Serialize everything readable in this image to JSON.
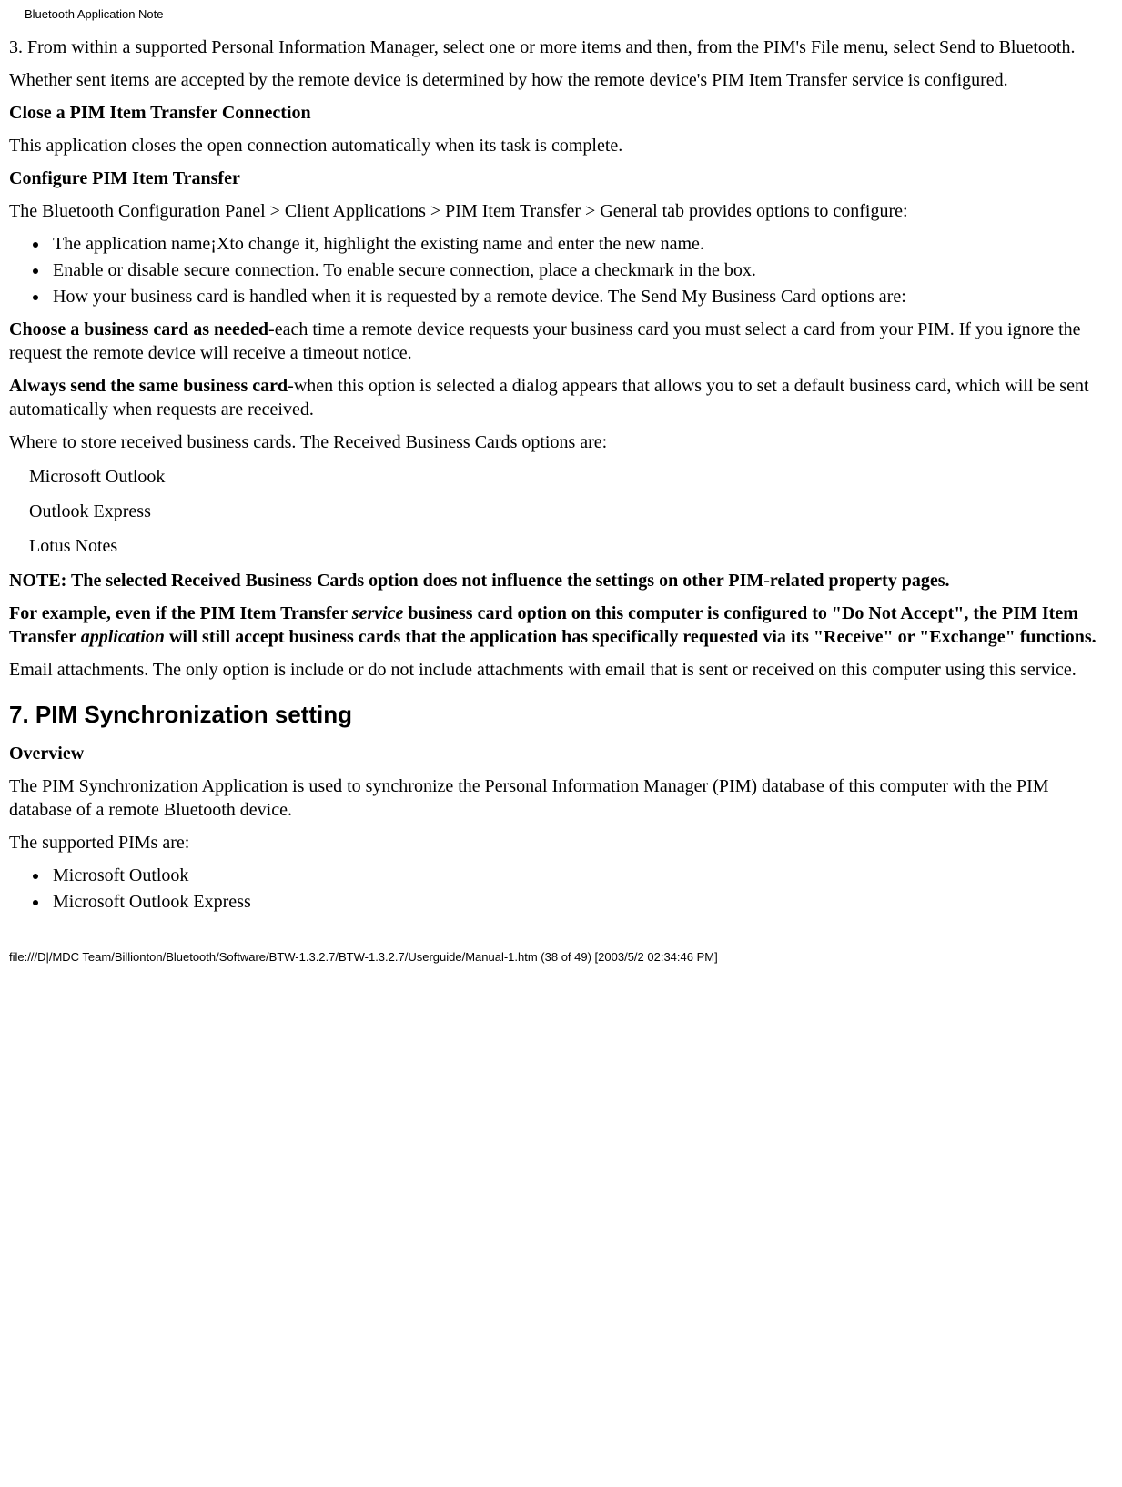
{
  "header": "Bluetooth Application Note",
  "p1": "3. From within a supported Personal Information Manager, select one or more items and then, from the PIM's File menu, select Send to Bluetooth.",
  "p2": "Whether sent items are accepted by the remote device is determined by how the remote device's PIM Item Transfer service is configured.",
  "h_close": "Close a PIM Item Transfer Connection",
  "p3": "This application closes the open connection automatically when its task is complete.",
  "h_configure": "Configure PIM Item Transfer",
  "p4": "The Bluetooth Configuration Panel > Client Applications > PIM Item Transfer > General tab provides options to configure:",
  "bullets1": {
    "b1": " The application name¡Xto change it, highlight the existing name and enter the new name.",
    "b2": "Enable or disable secure connection. To enable secure connection, place a checkmark in the box.",
    "b3": "How your business card is handled when it is requested by a remote device. The Send My Business Card options are:"
  },
  "choose_bold": "Choose a business card as needed",
  "choose_rest": "-each time a remote device requests your business card you must select a card from your PIM. If you ignore the request the remote device will receive a timeout notice.",
  "always_bold": "Always send the same business card",
  "always_rest": "-when this option is selected a dialog appears that allows you to set a default business card, which will be sent automatically when requests are received.",
  "p_where": "Where to store received business cards. The Received Business Cards options are:",
  "opts": {
    "o1": " Microsoft Outlook",
    "o2": " Outlook Express",
    "o3": "Lotus Notes"
  },
  "note1": "NOTE: The selected Received Business Cards option does not influence the settings on other PIM-related property pages.",
  "note2a": "For example, even if the PIM Item Transfer ",
  "note2_i1": "service",
  "note2b": " business card option on this computer is configured to \"Do Not Accept\", the PIM Item Transfer ",
  "note2_i2": "application",
  "note2c": " will still accept business cards that the application has specifically requested via its \"Receive\" or \"Exchange\" functions.",
  "p_email": "Email attachments. The only option is include or do not include attachments with email that is sent or received on this computer using this service.",
  "h7": "7. PIM Synchronization setting",
  "h_overview": "Overview",
  "p_overview": "The PIM Synchronization Application is used to synchronize the Personal Information Manager (PIM) database of this computer with the PIM database of a remote Bluetooth device.",
  "p_supported": "The supported PIMs are:",
  "bullets2": {
    "b1": "Microsoft Outlook",
    "b2": "Microsoft Outlook Express"
  },
  "footer": "file:///D|/MDC Team/Billionton/Bluetooth/Software/BTW-1.3.2.7/BTW-1.3.2.7/Userguide/Manual-1.htm (38 of 49) [2003/5/2 02:34:46 PM]"
}
